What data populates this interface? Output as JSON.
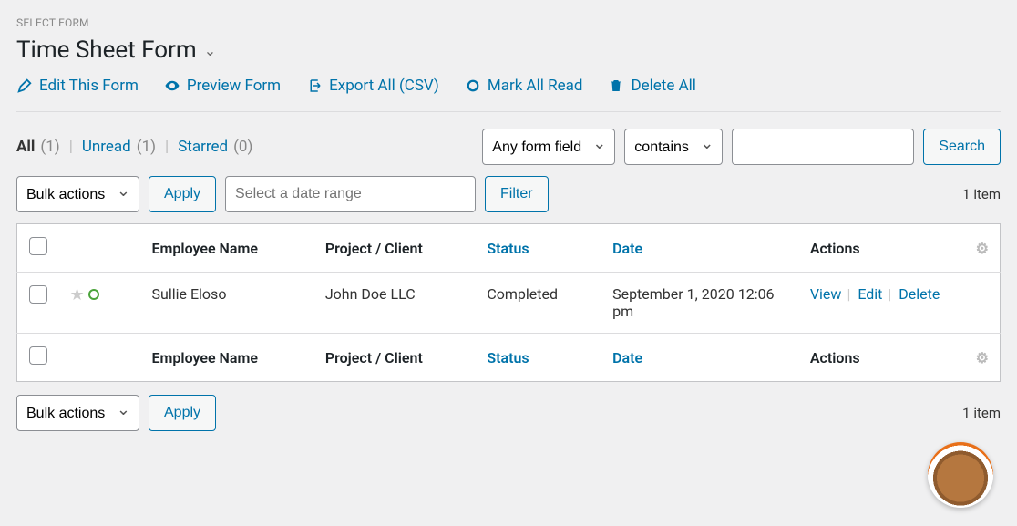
{
  "labels": {
    "select_form": "SELECT FORM"
  },
  "form": {
    "title": "Time Sheet Form"
  },
  "actions": {
    "edit": "Edit This Form",
    "preview": "Preview Form",
    "export": "Export All (CSV)",
    "mark_read": "Mark All Read",
    "delete_all": "Delete All"
  },
  "views": {
    "all_label": "All",
    "all_count": "(1)",
    "unread_label": "Unread",
    "unread_count": "(1)",
    "starred_label": "Starred",
    "starred_count": "(0)"
  },
  "search": {
    "field_option": "Any form field",
    "operator_option": "contains",
    "value": "",
    "button": "Search"
  },
  "bulk": {
    "option": "Bulk actions",
    "apply": "Apply"
  },
  "date_filter": {
    "placeholder": "Select a date range",
    "button": "Filter"
  },
  "pagination": {
    "items": "1 item"
  },
  "table": {
    "cols": {
      "employee": "Employee Name",
      "project": "Project / Client",
      "status": "Status",
      "date": "Date",
      "actions": "Actions"
    },
    "rows": [
      {
        "employee": "Sullie Eloso",
        "project": "John Doe LLC",
        "status": "Completed",
        "date": "September 1, 2020 12:06 pm"
      }
    ],
    "row_actions": {
      "view": "View",
      "edit": "Edit",
      "delete": "Delete"
    }
  }
}
